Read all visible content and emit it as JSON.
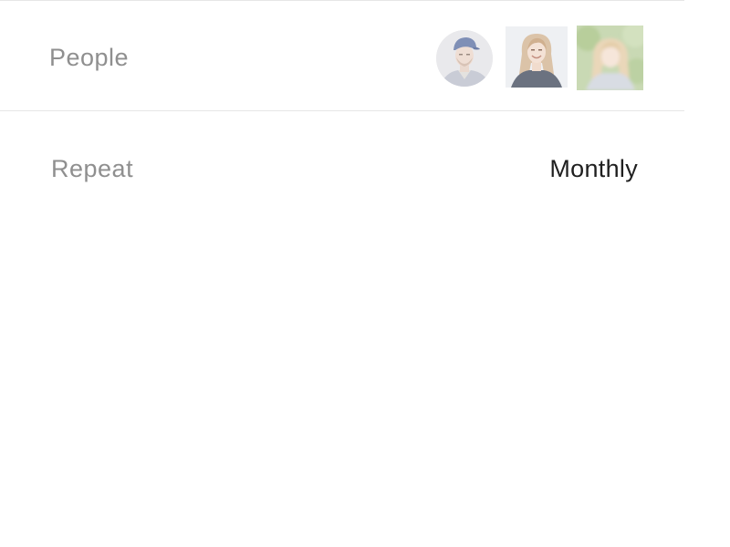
{
  "people": {
    "label": "People",
    "avatars": [
      {
        "name": "avatar-man-cap"
      },
      {
        "name": "avatar-woman-smiling"
      },
      {
        "name": "avatar-woman-blurred"
      }
    ]
  },
  "repeat": {
    "label": "Repeat",
    "value": "Monthly"
  }
}
